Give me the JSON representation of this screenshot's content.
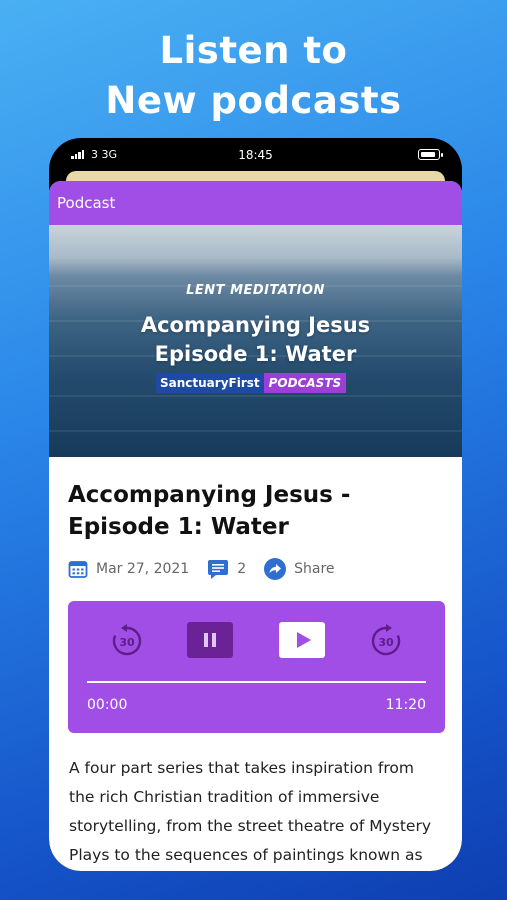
{
  "promo": {
    "line1": "Listen to",
    "line2": "New podcasts"
  },
  "status_bar": {
    "carrier": "3  3G",
    "time": "18:45"
  },
  "app_bar": {
    "title": "Podcast"
  },
  "hero": {
    "kicker": "LENT MEDITATION",
    "title_line1": "Acompanying Jesus",
    "title_line2": "Episode 1: Water",
    "brand_left": "SanctuaryFirst",
    "brand_right": "PODCASTS"
  },
  "episode": {
    "title": "Accompanying Jesus - Episode 1: Water",
    "date": "Mar 27, 2021",
    "comments": "2",
    "share_label": "Share"
  },
  "player": {
    "current_time": "00:00",
    "duration": "11:20",
    "progress": 0,
    "skip_back_seconds": "30",
    "skip_forward_seconds": "30",
    "accent": "#a14ee6"
  },
  "description": "A four part series that takes inspiration from the rich Christian tradition of immersive storytelling, from the street theatre of Mystery Plays to the sequences of paintings known as"
}
